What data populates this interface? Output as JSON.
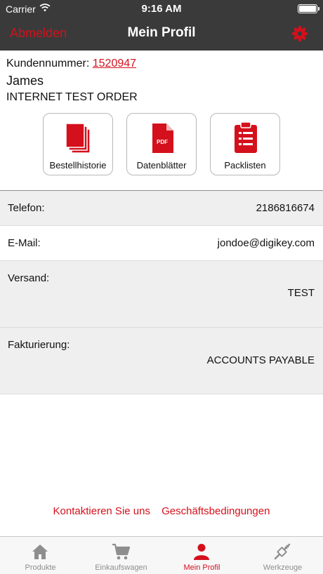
{
  "status": {
    "carrier": "Carrier",
    "time": "9:16 AM"
  },
  "nav": {
    "logout": "Abmelden",
    "title": "Mein Profil",
    "settings_icon": "gear-icon"
  },
  "customer": {
    "number_label": "Kundennummer:",
    "number": "1520947",
    "name": "James",
    "company": "INTERNET TEST ORDER"
  },
  "tiles": [
    {
      "label": "Bestellhistorie",
      "icon": "stacked-documents-icon"
    },
    {
      "label": "Datenblätter",
      "icon": "pdf-document-icon",
      "badge": "PDF"
    },
    {
      "label": "Packlisten",
      "icon": "clipboard-icon"
    }
  ],
  "info": {
    "phone": {
      "label": "Telefon:",
      "value": "2186816674"
    },
    "email": {
      "label": "E-Mail:",
      "value": "jondoe@digikey.com"
    },
    "shipping": {
      "label": "Versand:",
      "value": "TEST"
    },
    "billing": {
      "label": "Fakturierung:",
      "value": "ACCOUNTS PAYABLE"
    }
  },
  "footer": {
    "contact": "Kontaktieren Sie uns",
    "terms": "Geschäftsbedingungen"
  },
  "tabbar": [
    {
      "label": "Produkte",
      "icon": "home-icon"
    },
    {
      "label": "Einkaufswagen",
      "icon": "cart-icon"
    },
    {
      "label": "Mein Profil",
      "icon": "person-icon",
      "active": true
    },
    {
      "label": "Werkzeuge",
      "icon": "tools-icon"
    }
  ],
  "colors": {
    "accent": "#d4101c",
    "bar": "#3a3a3a",
    "row_gray": "#efefef"
  }
}
